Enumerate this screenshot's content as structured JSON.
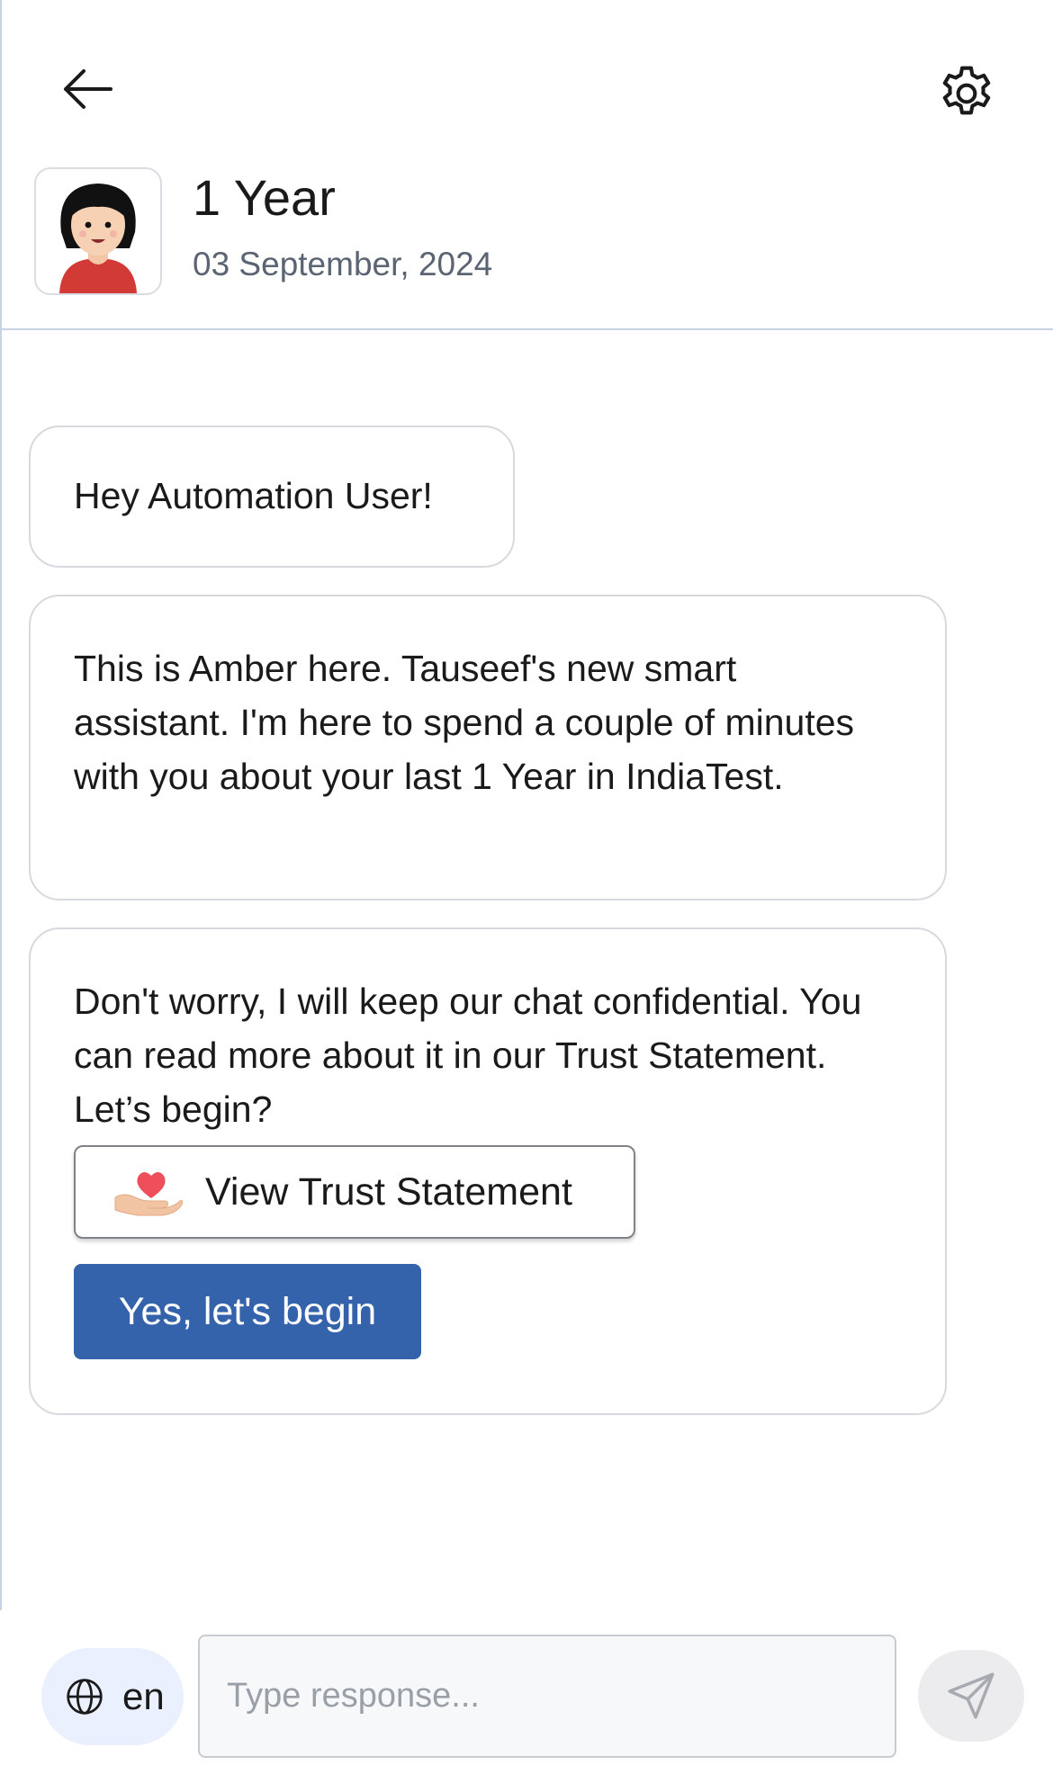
{
  "header": {
    "back_icon": "arrow-left-icon",
    "settings_icon": "gear-icon",
    "title": "1 Year",
    "date": "03 September, 2024",
    "avatar_icon": "assistant-avatar-icon"
  },
  "messages": [
    {
      "text": "Hey Automation User!"
    },
    {
      "text": "This is Amber here. Tauseef's new smart assistant. I'm here to spend a couple of minutes with you about your last 1 Year in IndiaTest."
    },
    {
      "text": "Don't worry, I will keep our chat confidential. You can read more about it in our Trust Statement. Let’s begin?"
    }
  ],
  "actions": {
    "trust_label": "View Trust Statement",
    "trust_icon": "heart-hand-icon",
    "begin_label": "Yes, let's begin"
  },
  "footer": {
    "language": "en",
    "globe_icon": "globe-icon",
    "input_placeholder": "Type response...",
    "send_icon": "send-icon"
  },
  "colors": {
    "primary": "#3563ab",
    "language_pill": "#eaf0fd",
    "send_button": "#ececee",
    "divider": "#c9d2e3"
  }
}
